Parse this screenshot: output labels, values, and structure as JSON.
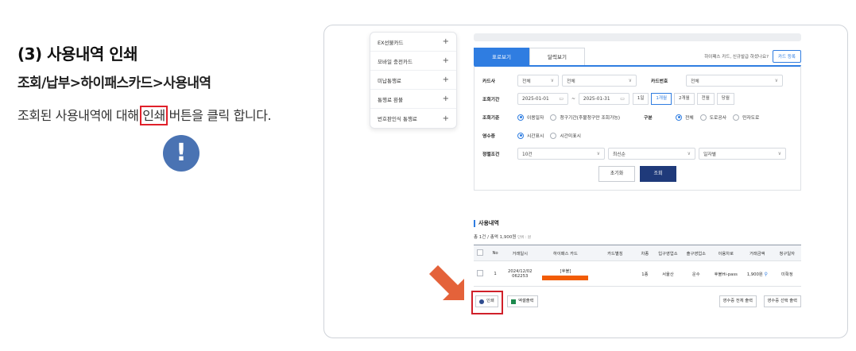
{
  "guide": {
    "title": "(3) 사용내역 인쇄",
    "subtitle": "조회/납부>하이패스카드>사용내역",
    "desc_before": "조회된 사용내역에 대해 ",
    "desc_highlight": "인쇄",
    "desc_after": " 버튼을 클릭 합니다.",
    "alert_glyph": "!"
  },
  "sidebar": {
    "items": [
      {
        "label": "EX선불카드",
        "sign": "+"
      },
      {
        "label": "모바일 충전카드",
        "sign": "+"
      },
      {
        "label": "미납통행료",
        "sign": "+"
      },
      {
        "label": "통행료 환불",
        "sign": "+"
      },
      {
        "label": "번호판인식 통행료",
        "sign": "+"
      }
    ]
  },
  "tabs": {
    "active": "표로보기",
    "inactive": "달력보기",
    "prompt": "하이패스 카드, 신규발급 하셨나요?",
    "register_button": "카드 등록"
  },
  "filter": {
    "card_company_label": "카드사",
    "card_company_value": "전체",
    "card_type_value": "전체",
    "card_number_label": "카드번호",
    "card_number_value": "전체",
    "period_label": "조회기간",
    "date_from": "2025-01-01",
    "date_to": "2025-01-31",
    "tilde": "~",
    "periods": [
      "1일",
      "1개월",
      "2개월",
      "전월",
      "당월"
    ],
    "active_period": "1개월",
    "criteria_label": "조회기준",
    "criteria_opts": [
      "이용일자",
      "청구기간(후불청구만 조회가능)"
    ],
    "division_label": "구분",
    "division_opts": [
      "전체",
      "도로공사",
      "민자도로"
    ],
    "receipt_label": "영수증",
    "receipt_opts": [
      "시간표시",
      "시간미표시"
    ],
    "sort_label": "정렬조건",
    "sort_count": "10건",
    "sort_order": "최신순",
    "sort_by": "일자별",
    "reset_button": "초기화",
    "search_button": "조회"
  },
  "usage": {
    "title": "사용내역",
    "total": "총 1건 / 총액 1,900원",
    "unit": "단위 : 원",
    "headers": [
      "No",
      "거래일시",
      "하이패스 카드",
      "카드별칭",
      "차종",
      "입구영업소",
      "출구영업소",
      "이용차로",
      "거래금액",
      "청구일자"
    ],
    "row": {
      "no": "1",
      "datetime_1": "2024/12/02",
      "datetime_2": "062253",
      "card_type": "[후불]",
      "alias": "",
      "car_class": "1종",
      "entry": "서울산",
      "exit": "운수",
      "lane": "후불Hi-pass",
      "amount": "1,900원",
      "billing": "미확정"
    }
  },
  "actions": {
    "print": "인쇄",
    "excel": "엑셀출력",
    "receipt_all": "영수증 전체 출력",
    "receipt_selected": "영수증 선택 출력"
  },
  "colors": {
    "accent": "#2f7de1",
    "highlight": "#e0202a",
    "arrow": "#e4623a",
    "alert": "#4a73b3"
  }
}
